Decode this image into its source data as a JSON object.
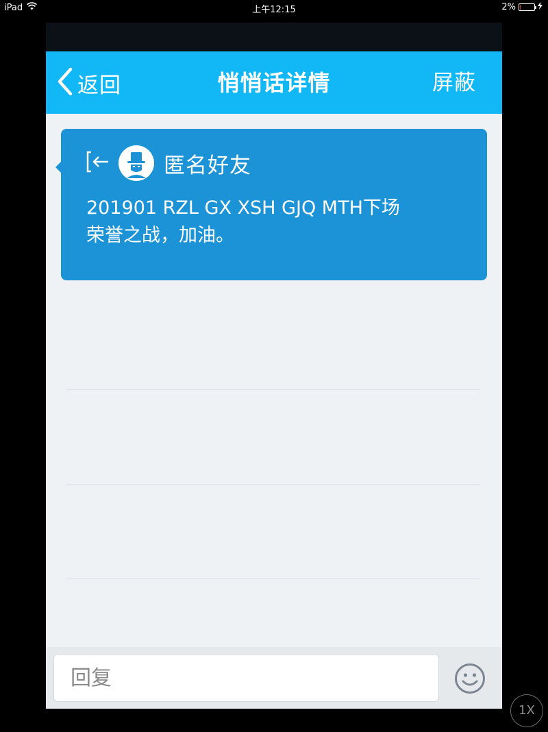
{
  "status_bar": {
    "device": "iPad",
    "time": "上午12:15",
    "battery": "2%",
    "battery_level": 0.02
  },
  "nav": {
    "back_label": "返回",
    "title": "悄悄话详情",
    "block_label": "屏蔽"
  },
  "message": {
    "sender": "匿名好友",
    "text_line1": "201901 RZL GX XSH GJQ MTH下场",
    "text_line2": "荣誉之战，加油。"
  },
  "reply": {
    "placeholder": "回复"
  },
  "zoom": {
    "label": "1X"
  },
  "colors": {
    "nav_bg": "#12b7f5",
    "card_bg": "#1b93d6",
    "page_bg": "#eff2f5"
  },
  "icons": [
    "wifi-icon",
    "charging-icon",
    "back-chevron-icon",
    "enter-arrow-icon",
    "anonymous-avatar-icon",
    "emoji-icon"
  ]
}
